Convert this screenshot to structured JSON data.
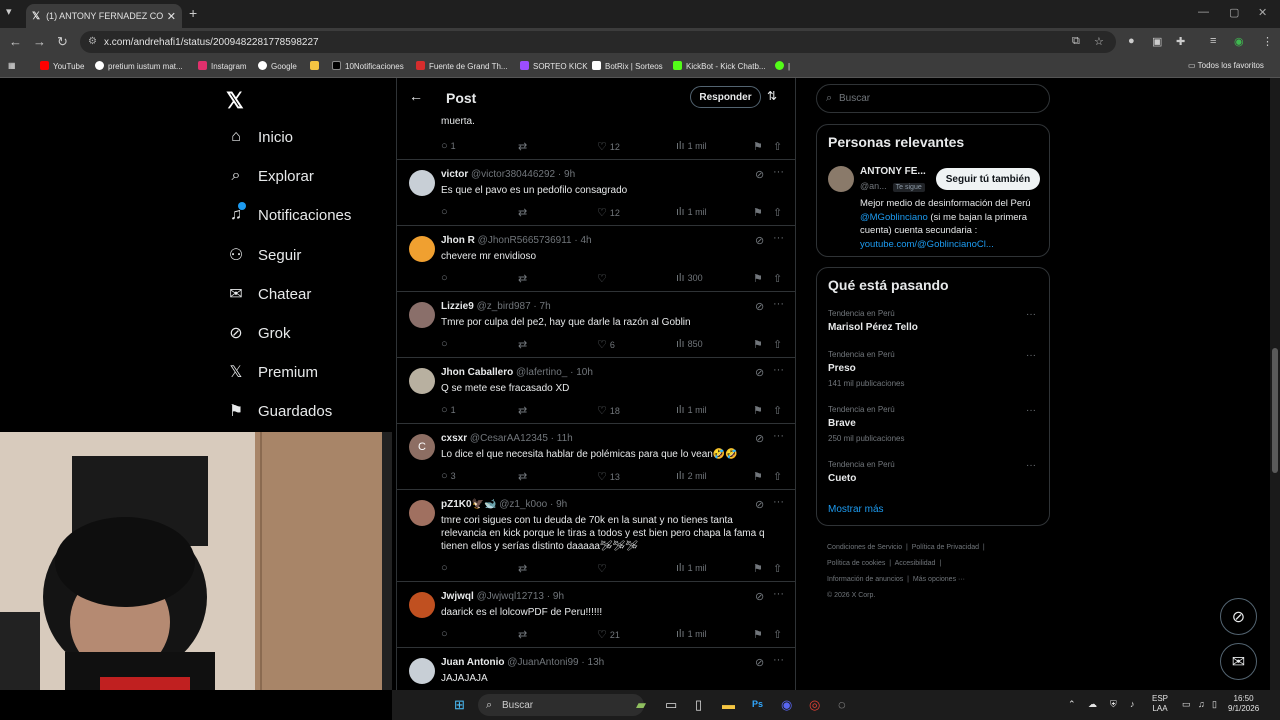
{
  "browser": {
    "tab_title": "(1) ANTONY FERNADEZ CORI e",
    "url": "x.com/andrehafi1/status/2009482281778598227",
    "bookmarks": [
      {
        "label": "YouTube",
        "color": "#ff0000"
      },
      {
        "label": "pretium iustum mat...",
        "color": "#ffffff"
      },
      {
        "label": "Instagram",
        "color": "#e1306c"
      },
      {
        "label": "Google",
        "color": "#ffffff"
      },
      {
        "label": "",
        "color": "#f5c542"
      },
      {
        "label": "10Notificaciones",
        "color": "#000000"
      },
      {
        "label": "Fuente de Grand Th...",
        "color": "#d62d2d"
      },
      {
        "label": "SORTEO KICK",
        "color": "#9b4dff"
      },
      {
        "label": "BotRix | Sorteos",
        "color": "#ffffff"
      },
      {
        "label": "KickBot - Kick Chatb...",
        "color": "#53fc18"
      }
    ],
    "all_favorites": "Todos los favoritos"
  },
  "sidebar": {
    "items": [
      {
        "label": "Inicio",
        "icon": "home-icon"
      },
      {
        "label": "Explorar",
        "icon": "search-icon"
      },
      {
        "label": "Notificaciones",
        "icon": "bell-icon"
      },
      {
        "label": "Seguir",
        "icon": "add-person-icon"
      },
      {
        "label": "Chatear",
        "icon": "mail-icon"
      },
      {
        "label": "Grok",
        "icon": "grok-icon"
      },
      {
        "label": "Premium",
        "icon": "x-icon"
      },
      {
        "label": "Guardados",
        "icon": "bookmark-icon"
      }
    ]
  },
  "post": {
    "title": "Post",
    "reply_button": "Responder",
    "prev_text": "muerta.",
    "prev_stats": {
      "replies": "1",
      "likes": "12",
      "views": "1 mil"
    }
  },
  "replies": [
    {
      "name": "victor",
      "handle": "@victor380446292",
      "time": "9h",
      "text": "Es que el pavo es un pedofilo consagrado",
      "replies": "",
      "likes": "12",
      "views": "1 mil",
      "avatar_color": "#c8cfd6"
    },
    {
      "name": "Jhon R",
      "handle": "@JhonR5665736911",
      "time": "4h",
      "text": "chevere mr envidioso",
      "replies": "",
      "likes": "",
      "views": "300",
      "avatar_color": "#f0a030"
    },
    {
      "name": "Lizzie9",
      "handle": "@z_bird987",
      "time": "7h",
      "text": "Tmre por culpa del pe2, hay que darle la razón al Goblin",
      "replies": "",
      "likes": "6",
      "views": "850",
      "avatar_color": "#8a6f6a"
    },
    {
      "name": "Jhon Caballero",
      "handle": "@lafertino_",
      "time": "10h",
      "text": "Q se mete ese fracasado XD",
      "replies": "1",
      "likes": "18",
      "views": "1 mil",
      "avatar_color": "#b8b0a0"
    },
    {
      "name": "cxsxr",
      "handle": "@CesarAA12345",
      "time": "11h",
      "text": "Lo dice el que necesita hablar de polémicas para que lo vean🤣🤣",
      "replies": "3",
      "likes": "13",
      "views": "2 mil",
      "avatar_color": "#8d6e63",
      "initial": "C"
    },
    {
      "name": "pZ1K0🦅🐋",
      "handle": "@z1_k0oo",
      "time": "9h",
      "text": "tmre cori sigues con tu deuda de 70k en la sunat y no tienes tanta relevancia en kick porque le tiras a todos y est bien pero chapa la fama q tienen ellos y serías distinto daaaaa🛩🛩🛩",
      "replies": "",
      "likes": "",
      "views": "1 mil",
      "avatar_color": "#a07060"
    },
    {
      "name": "Jwjwql",
      "handle": "@Jwjwql12713",
      "time": "9h",
      "text": "daarick es  el lolcowPDF de Peru!!!!!!",
      "replies": "",
      "likes": "21",
      "views": "1 mil",
      "avatar_color": "#c05020"
    },
    {
      "name": "Juan Antonio",
      "handle": "@JuanAntoni99",
      "time": "13h",
      "text": "JAJAJAJA",
      "replies": "",
      "likes": "",
      "views": "",
      "avatar_color": "#c8cfd6"
    }
  ],
  "right": {
    "search_placeholder": "Buscar",
    "relevant_title": "Personas relevantes",
    "person": {
      "name": "ANTONY FE...",
      "handle": "@an...",
      "follows_you": "Te sigue",
      "follow_back": "Seguir tú también",
      "bio_pre": "Mejor medio de desinformación del Perú ",
      "bio_mention": "@MGoblinciano",
      "bio_mid": " (si me bajan la primera cuenta) cuenta secundaria : ",
      "bio_link": "youtube.com/@GoblincianoCl..."
    },
    "trends_title": "Qué está pasando",
    "trends": [
      {
        "context": "Tendencia en Perú",
        "name": "Marisol Pérez Tello",
        "count": ""
      },
      {
        "context": "Tendencia en Perú",
        "name": "Preso",
        "count": "141 mil publicaciones"
      },
      {
        "context": "Tendencia en Perú",
        "name": "Brave",
        "count": "250 mil publicaciones"
      },
      {
        "context": "Tendencia en Perú",
        "name": "Cueto",
        "count": ""
      }
    ],
    "show_more": "Mostrar más",
    "footer": {
      "terms": "Condiciones de Servicio",
      "privacy": "Política de Privacidad",
      "cookies": "Política de cookies",
      "accessibility": "Accesibilidad",
      "ads": "Información de anuncios",
      "more": "Más opciones ···",
      "copyright": "© 2026 X Corp."
    }
  },
  "taskbar": {
    "search": "Buscar",
    "lang": "ESP",
    "lang2": "LAA",
    "time": "16:50",
    "date": "9/1/2026"
  }
}
